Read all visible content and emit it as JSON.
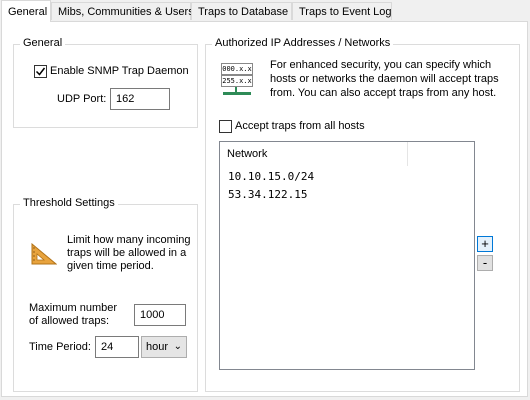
{
  "tabs": [
    {
      "label": "General"
    },
    {
      "label": "Mibs, Communities & Users"
    },
    {
      "label": "Traps to Database"
    },
    {
      "label": "Traps to Event Log"
    }
  ],
  "general": {
    "title": "General",
    "enable_label": "Enable SNMP Trap Daemon",
    "enable_checked": true,
    "udp_label": "UDP Port:",
    "udp_value": "162"
  },
  "threshold": {
    "title": "Threshold Settings",
    "description": "Limit how many incoming traps will be allowed in a given time period.",
    "max_label": "Maximum number of allowed traps:",
    "max_value": "1000",
    "period_label": "Time Period:",
    "period_value": "24",
    "period_unit": "hour"
  },
  "authorized": {
    "title": "Authorized IP Addresses / Networks",
    "description": "For enhanced security, you can specify which hosts or networks the daemon will accept traps from. You can also accept traps from any host.",
    "icon_line1": "000.x.x",
    "icon_line2": "255.x.x",
    "accept_all_label": "Accept traps from all hosts",
    "accept_all_checked": false,
    "column_header": "Network",
    "networks": [
      "10.10.15.0/24",
      "53.34.122.15"
    ],
    "add_label": "+",
    "remove_label": "-"
  }
}
